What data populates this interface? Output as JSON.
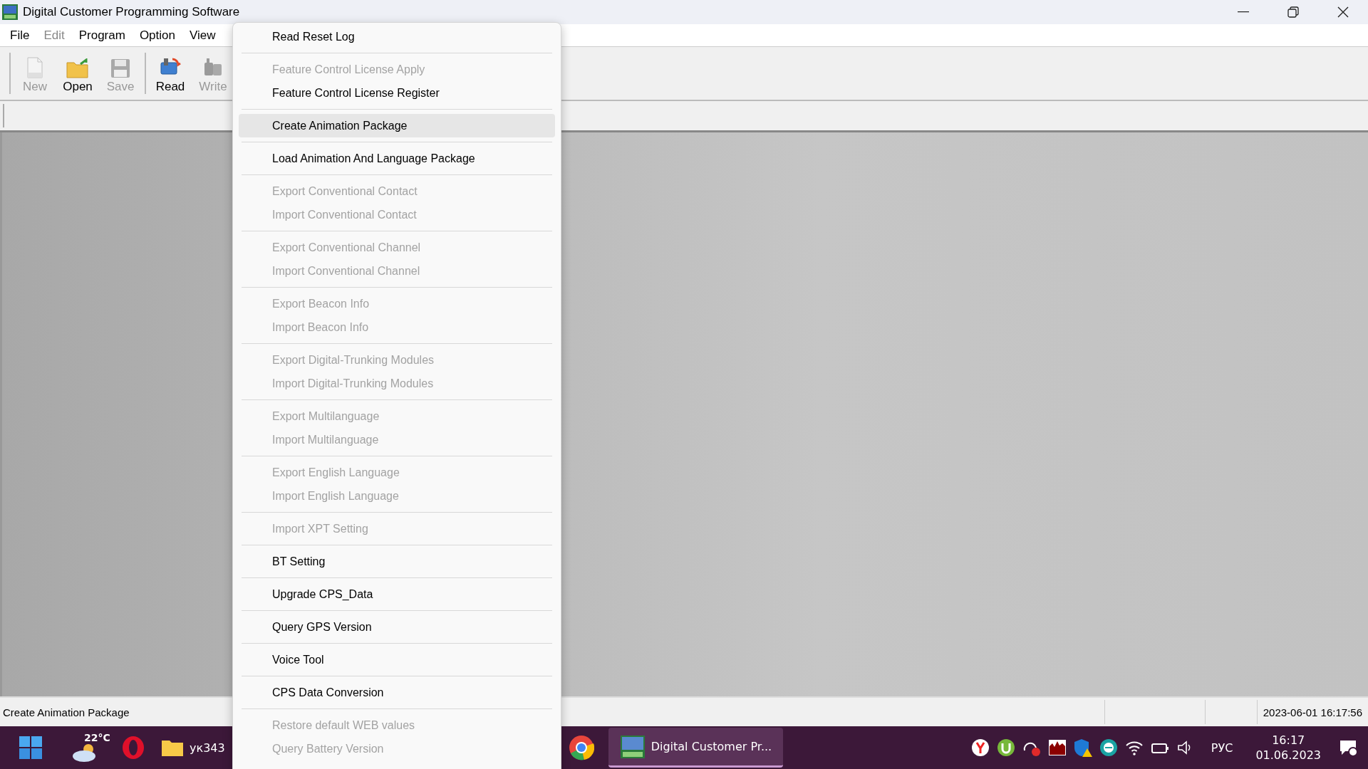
{
  "window": {
    "title": "Digital Customer Programming Software"
  },
  "menu_bar": [
    {
      "label": "File",
      "disabled": false
    },
    {
      "label": "Edit",
      "disabled": true
    },
    {
      "label": "Program",
      "disabled": false
    },
    {
      "label": "Option",
      "disabled": false
    },
    {
      "label": "View",
      "disabled": false
    }
  ],
  "toolbar": [
    [
      {
        "kind": "new",
        "label": "New",
        "disabled": true
      },
      {
        "kind": "open",
        "label": "Open",
        "disabled": false
      },
      {
        "kind": "save",
        "label": "Save",
        "disabled": true
      }
    ],
    [
      {
        "kind": "read",
        "label": "Read",
        "disabled": false
      },
      {
        "kind": "write",
        "label": "Write",
        "disabled": true
      }
    ]
  ],
  "dropdown_menu": [
    [
      {
        "label": "Read Reset Log",
        "disabled": false,
        "selected": false
      }
    ],
    [
      {
        "label": "Feature Control License Apply",
        "disabled": true,
        "selected": false
      },
      {
        "label": "Feature Control License Register",
        "disabled": false,
        "selected": false
      }
    ],
    [
      {
        "label": "Create Animation Package",
        "disabled": false,
        "selected": true
      }
    ],
    [
      {
        "label": "Load Animation And Language Package",
        "disabled": false,
        "selected": false
      }
    ],
    [
      {
        "label": "Export Conventional Contact",
        "disabled": true,
        "selected": false
      },
      {
        "label": "Import Conventional Contact",
        "disabled": true,
        "selected": false
      }
    ],
    [
      {
        "label": "Export Conventional Channel",
        "disabled": true,
        "selected": false
      },
      {
        "label": "Import Conventional Channel",
        "disabled": true,
        "selected": false
      }
    ],
    [
      {
        "label": "Export Beacon Info",
        "disabled": true,
        "selected": false
      },
      {
        "label": "Import Beacon Info",
        "disabled": true,
        "selected": false
      }
    ],
    [
      {
        "label": "Export Digital-Trunking Modules",
        "disabled": true,
        "selected": false
      },
      {
        "label": "Import Digital-Trunking Modules",
        "disabled": true,
        "selected": false
      }
    ],
    [
      {
        "label": "Export Multilanguage",
        "disabled": true,
        "selected": false
      },
      {
        "label": "Import Multilanguage",
        "disabled": true,
        "selected": false
      }
    ],
    [
      {
        "label": "Export English Language",
        "disabled": true,
        "selected": false
      },
      {
        "label": "Import English Language",
        "disabled": true,
        "selected": false
      }
    ],
    [
      {
        "label": "Import XPT Setting",
        "disabled": true,
        "selected": false
      }
    ],
    [
      {
        "label": "BT Setting",
        "disabled": false,
        "selected": false
      }
    ],
    [
      {
        "label": "Upgrade CPS_Data",
        "disabled": false,
        "selected": false
      }
    ],
    [
      {
        "label": "Query GPS Version",
        "disabled": false,
        "selected": false
      }
    ],
    [
      {
        "label": "Voice Tool",
        "disabled": false,
        "selected": false
      }
    ],
    [
      {
        "label": "CPS Data Conversion",
        "disabled": false,
        "selected": false
      }
    ],
    [
      {
        "label": "Restore default WEB values",
        "disabled": true,
        "selected": false
      },
      {
        "label": "Query Battery Version",
        "disabled": true,
        "selected": false
      }
    ]
  ],
  "status_bar": {
    "message": "Create Animation Package",
    "datetime": "2023-06-01 16:17:56"
  },
  "taskbar": {
    "temperature": "22°C",
    "folder": "ук343",
    "active_app": {
      "label": "Digital Customer Pr...",
      "selected": true
    },
    "language": "РУС",
    "time": "16:17",
    "date": "01.06.2023"
  }
}
